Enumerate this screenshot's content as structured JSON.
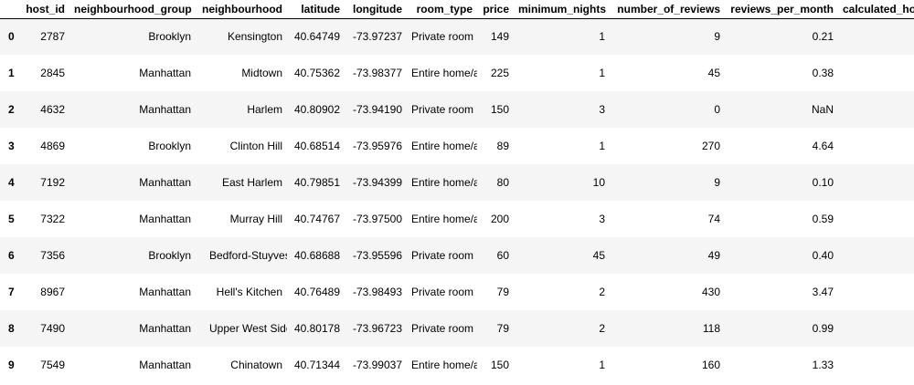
{
  "table": {
    "columns": [
      "",
      "host_id",
      "neighbourhood_group",
      "neighbourhood",
      "latitude",
      "longitude",
      "room_type",
      "price",
      "minimum_nights",
      "number_of_reviews",
      "reviews_per_month",
      "calculated_host_listings_count"
    ],
    "rows": [
      {
        "index": "0",
        "host_id": "2787",
        "neighbourhood_group": "Brooklyn",
        "neighbourhood": "Kensington",
        "latitude": "40.64749",
        "longitude": "-73.97237",
        "room_type": "Private room",
        "price": "149",
        "minimum_nights": "1",
        "number_of_reviews": "9",
        "reviews_per_month": "0.21"
      },
      {
        "index": "1",
        "host_id": "2845",
        "neighbourhood_group": "Manhattan",
        "neighbourhood": "Midtown",
        "latitude": "40.75362",
        "longitude": "-73.98377",
        "room_type": "Entire home/apt",
        "price": "225",
        "minimum_nights": "1",
        "number_of_reviews": "45",
        "reviews_per_month": "0.38"
      },
      {
        "index": "2",
        "host_id": "4632",
        "neighbourhood_group": "Manhattan",
        "neighbourhood": "Harlem",
        "latitude": "40.80902",
        "longitude": "-73.94190",
        "room_type": "Private room",
        "price": "150",
        "minimum_nights": "3",
        "number_of_reviews": "0",
        "reviews_per_month": "NaN"
      },
      {
        "index": "3",
        "host_id": "4869",
        "neighbourhood_group": "Brooklyn",
        "neighbourhood": "Clinton Hill",
        "latitude": "40.68514",
        "longitude": "-73.95976",
        "room_type": "Entire home/apt",
        "price": "89",
        "minimum_nights": "1",
        "number_of_reviews": "270",
        "reviews_per_month": "4.64"
      },
      {
        "index": "4",
        "host_id": "7192",
        "neighbourhood_group": "Manhattan",
        "neighbourhood": "East Harlem",
        "latitude": "40.79851",
        "longitude": "-73.94399",
        "room_type": "Entire home/apt",
        "price": "80",
        "minimum_nights": "10",
        "number_of_reviews": "9",
        "reviews_per_month": "0.10"
      },
      {
        "index": "5",
        "host_id": "7322",
        "neighbourhood_group": "Manhattan",
        "neighbourhood": "Murray Hill",
        "latitude": "40.74767",
        "longitude": "-73.97500",
        "room_type": "Entire home/apt",
        "price": "200",
        "minimum_nights": "3",
        "number_of_reviews": "74",
        "reviews_per_month": "0.59"
      },
      {
        "index": "6",
        "host_id": "7356",
        "neighbourhood_group": "Brooklyn",
        "neighbourhood": "Bedford-Stuyvesant",
        "latitude": "40.68688",
        "longitude": "-73.95596",
        "room_type": "Private room",
        "price": "60",
        "minimum_nights": "45",
        "number_of_reviews": "49",
        "reviews_per_month": "0.40"
      },
      {
        "index": "7",
        "host_id": "8967",
        "neighbourhood_group": "Manhattan",
        "neighbourhood": "Hell's Kitchen",
        "latitude": "40.76489",
        "longitude": "-73.98493",
        "room_type": "Private room",
        "price": "79",
        "minimum_nights": "2",
        "number_of_reviews": "430",
        "reviews_per_month": "3.47"
      },
      {
        "index": "8",
        "host_id": "7490",
        "neighbourhood_group": "Manhattan",
        "neighbourhood": "Upper West Side",
        "latitude": "40.80178",
        "longitude": "-73.96723",
        "room_type": "Private room",
        "price": "79",
        "minimum_nights": "2",
        "number_of_reviews": "118",
        "reviews_per_month": "0.99"
      },
      {
        "index": "9",
        "host_id": "7549",
        "neighbourhood_group": "Manhattan",
        "neighbourhood": "Chinatown",
        "latitude": "40.71344",
        "longitude": "-73.99037",
        "room_type": "Entire home/apt",
        "price": "150",
        "minimum_nights": "1",
        "number_of_reviews": "160",
        "reviews_per_month": "1.33"
      }
    ]
  }
}
